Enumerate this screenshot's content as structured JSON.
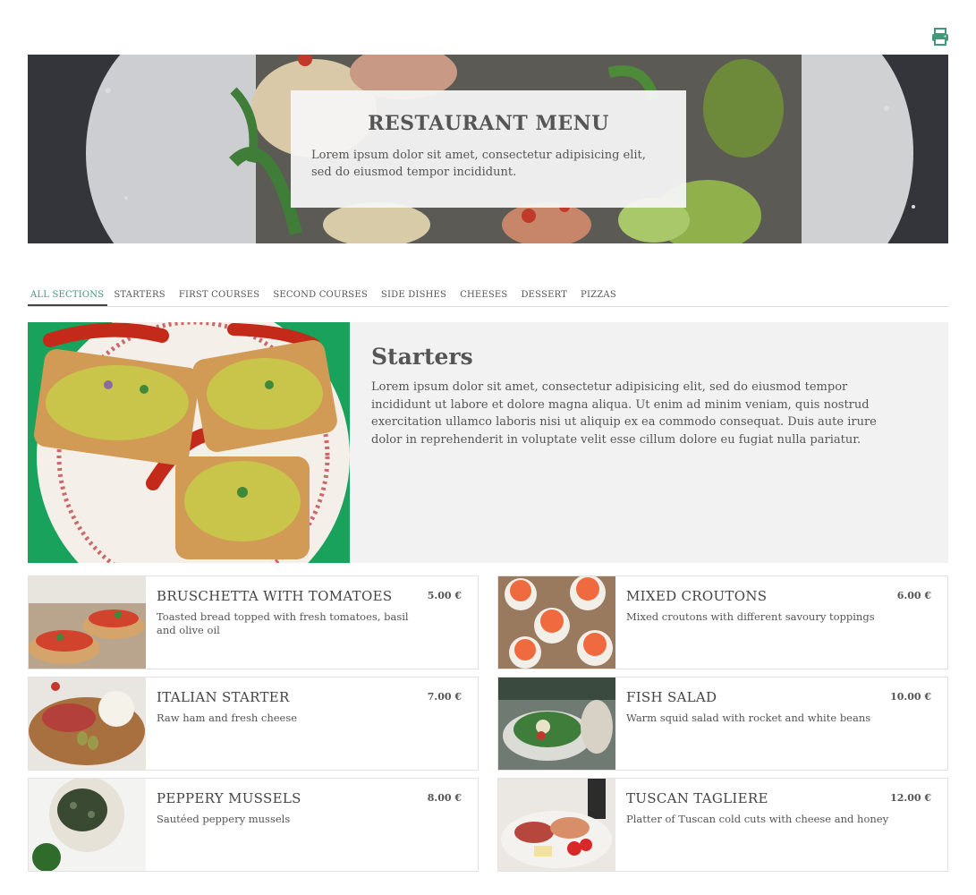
{
  "toolbar": {
    "print_icon": "printer-icon",
    "accent_color": "#3e9b7a"
  },
  "hero": {
    "title": "RESTAURANT MENU",
    "description": "Lorem ipsum dolor sit amet, consectetur adipisicing elit, sed do eiusmod tempor incididunt."
  },
  "tabs": [
    {
      "label": "ALL SECTIONS",
      "active": true
    },
    {
      "label": "STARTERS"
    },
    {
      "label": "FIRST COURSES"
    },
    {
      "label": "SECOND COURSES"
    },
    {
      "label": "SIDE DISHES"
    },
    {
      "label": "CHEESES"
    },
    {
      "label": "DESSERT"
    },
    {
      "label": "PIZZAS"
    }
  ],
  "section": {
    "title": "Starters",
    "description": "Lorem ipsum dolor sit amet, consectetur adipisicing elit, sed do eiusmod tempor incididunt ut labore et dolore magna aliqua. Ut enim ad minim veniam, quis nostrud exercitation ullamco laboris nisi ut aliquip ex ea commodo consequat. Duis aute irure dolor in reprehenderit in voluptate velit esse cillum dolore eu fugiat nulla pariatur."
  },
  "items": [
    {
      "name": "BRUSCHETTA WITH TOMATOES",
      "price": "5.00 €",
      "description": "Toasted bread topped with fresh tomatoes, basil and olive oil"
    },
    {
      "name": "MIXED CROUTONS",
      "price": "6.00 €",
      "description": "Mixed croutons with different savoury toppings"
    },
    {
      "name": "ITALIAN STARTER",
      "price": "7.00 €",
      "description": "Raw ham and fresh cheese"
    },
    {
      "name": "FISH SALAD",
      "price": "10.00 €",
      "description": "Warm squid salad with rocket and white beans"
    },
    {
      "name": "PEPPERY MUSSELS",
      "price": "8.00 €",
      "description": "Sautéed peppery mussels"
    },
    {
      "name": "TUSCAN TAGLIERE",
      "price": "12.00 €",
      "description": "Platter of Tuscan cold cuts with cheese and honey"
    }
  ]
}
